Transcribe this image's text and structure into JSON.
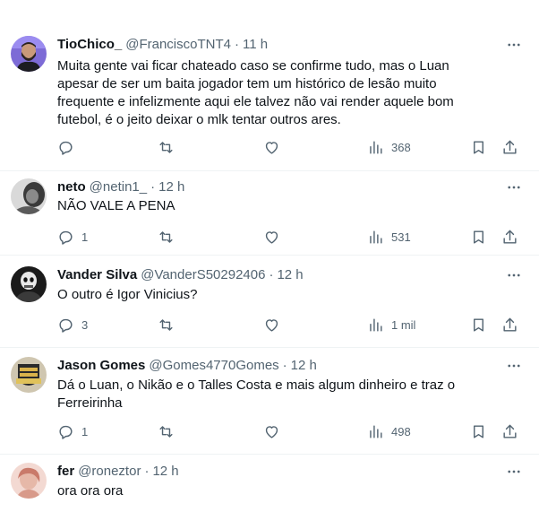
{
  "tweets": [
    {
      "name": "TioChico_",
      "handle": "@FranciscoTNT4",
      "separator": "·",
      "time": "11 h",
      "text": "Muita gente vai ficar chateado caso se confirme tudo, mas o Luan apesar de ser um baita jogador tem um histórico de lesão muito frequente e infelizmente aqui ele talvez não vai render aquele bom futebol, é o jeito deixar o mlk tentar outros ares.",
      "replies": "",
      "retweets": "",
      "likes": "",
      "views": "368",
      "avatar": "avatar-man-beard"
    },
    {
      "name": "neto",
      "handle": "@netin1_",
      "separator": "·",
      "time": "12 h",
      "text": "NÃO VALE A PENA",
      "replies": "1",
      "retweets": "",
      "likes": "",
      "views": "531",
      "avatar": "avatar-grayscale"
    },
    {
      "name": "Vander Silva",
      "handle": "@VanderS50292406",
      "separator": "·",
      "time": "12 h",
      "text": "O outro é Igor Vinicius?",
      "replies": "3",
      "retweets": "",
      "likes": "",
      "views": "1 mil",
      "avatar": "avatar-dark-figure"
    },
    {
      "name": "Jason Gomes",
      "handle": "@Gomes4770Gomes",
      "separator": "·",
      "time": "12 h",
      "text": "Dá o Luan, o Nikão e o Talles Costa e mais algum dinheiro e traz o Ferreirinha",
      "replies": "1",
      "retweets": "",
      "likes": "",
      "views": "498",
      "avatar": "avatar-badge"
    },
    {
      "name": "fer",
      "handle": "@roneztor",
      "separator": "·",
      "time": "12 h",
      "text": "ora ora ora",
      "avatar": "avatar-pink"
    }
  ],
  "colors": {
    "text": "#0f1419",
    "muted": "#536471",
    "divider": "#eff3f4"
  },
  "icons": [
    "reply-icon",
    "retweet-icon",
    "like-icon",
    "views-icon",
    "bookmark-icon",
    "share-icon",
    "more-icon"
  ]
}
